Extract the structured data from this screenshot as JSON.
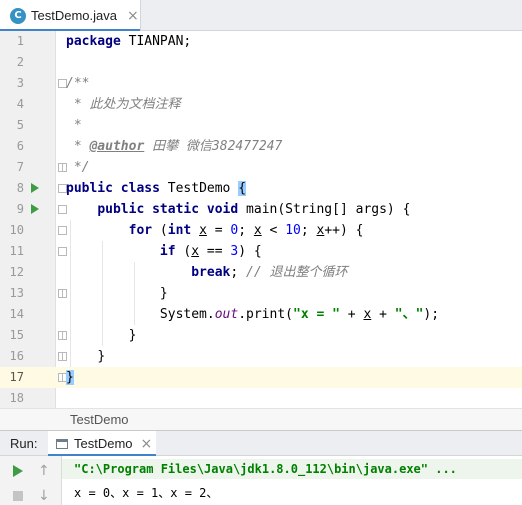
{
  "editor_tab": {
    "label": "TestDemo.java",
    "close": "×",
    "icon": "C"
  },
  "line_numbers": [
    "1",
    "2",
    "3",
    "4",
    "5",
    "6",
    "7",
    "8",
    "9",
    "10",
    "11",
    "12",
    "13",
    "14",
    "15",
    "16",
    "17",
    "18"
  ],
  "code": {
    "l1_kw": "package",
    "l1_rest": " TIANPAN;",
    "l3": "/**",
    "l4": " * 此处为文档注释",
    "l5": " *",
    "l6_pre": " * ",
    "l6_tag": "@author",
    "l6_rest": " 田攀 微信382477247",
    "l7": " */",
    "l8_kw1": "public",
    "l8_kw2": "class",
    "l8_name": " TestDemo ",
    "l8_brace": "{",
    "l9_kw1": "public",
    "l9_kw2": "static",
    "l9_kw3": "void",
    "l9_rest": " main(String[] args) {",
    "l10_kw1": "for",
    "l10_p1": " (",
    "l10_kw2": "int",
    "l10_x1": "x",
    "l10_p2": " = ",
    "l10_n1": "0",
    "l10_p3": "; ",
    "l10_x2": "x",
    "l10_p4": " < ",
    "l10_n2": "10",
    "l10_p5": "; ",
    "l10_x3": "x",
    "l10_p6": "++) {",
    "l11_kw": "if",
    "l11_p1": " (",
    "l11_x": "x",
    "l11_p2": " == ",
    "l11_n": "3",
    "l11_p3": ") {",
    "l12_kw": "break",
    "l12_p": "; ",
    "l12_cm": "// 退出整个循环",
    "l13": "}",
    "l14_p1": "System.",
    "l14_fld": "out",
    "l14_p2": ".print(",
    "l14_s1": "\"x = \"",
    "l14_p3": " + ",
    "l14_x": "x",
    "l14_p4": " + ",
    "l14_s2": "\"、\"",
    "l14_p5": ");",
    "l15": "}",
    "l16": "}",
    "l17": "}"
  },
  "breadcrumb": {
    "label": "TestDemo"
  },
  "run_panel": {
    "title": "Run:",
    "tab_label": "TestDemo",
    "tab_close": "×",
    "up_arrow": "↑",
    "down_arrow": "↓",
    "command": "\"C:\\Program Files\\Java\\jdk1.8.0_112\\bin\\java.exe\" ...",
    "output": "x = 0、x = 1、x = 2、"
  },
  "colors": {
    "keyword": "#000080",
    "comment": "#808080",
    "string": "#008000",
    "number": "#0000ff",
    "field": "#660e7a",
    "run_green": "#3e9c45",
    "tab_underline": "#4083c9",
    "current_line": "#fffae3"
  },
  "icons": [
    "java-class-icon",
    "run-gutter-icon",
    "fold-marker-icon",
    "rerun-icon",
    "stop-icon",
    "up-arrow-icon",
    "down-arrow-icon",
    "console-icon"
  ]
}
